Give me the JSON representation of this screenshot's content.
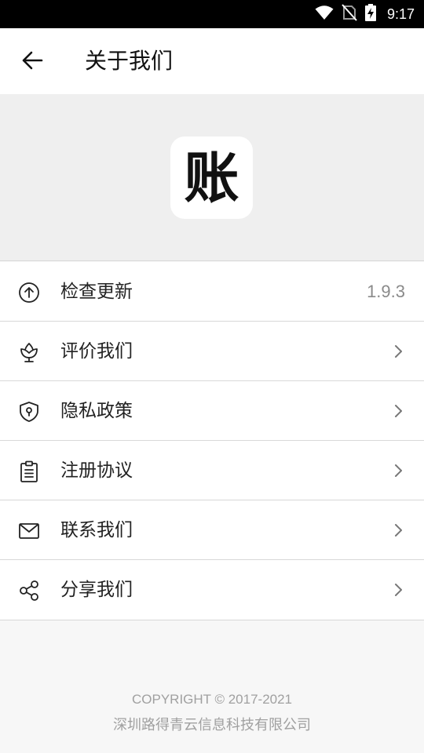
{
  "status_bar": {
    "time": "9:17",
    "icons": [
      "wifi-icon",
      "no-sim-icon",
      "battery-charging-icon"
    ]
  },
  "app_bar": {
    "back_icon": "arrow-left-icon",
    "title": "关于我们"
  },
  "hero": {
    "logo_text": "账"
  },
  "list": {
    "items": [
      {
        "icon": "arrow-up-circle-icon",
        "label": "检查更新",
        "value": "1.9.3"
      },
      {
        "icon": "flower-icon",
        "label": "评价我们"
      },
      {
        "icon": "shield-icon",
        "label": "隐私政策"
      },
      {
        "icon": "clipboard-icon",
        "label": "注册协议"
      },
      {
        "icon": "mail-icon",
        "label": "联系我们"
      },
      {
        "icon": "share-icon",
        "label": "分享我们"
      }
    ]
  },
  "footer": {
    "copyright": "COPYRIGHT © 2017-2021",
    "company": "深圳路得青云信息科技有限公司"
  }
}
